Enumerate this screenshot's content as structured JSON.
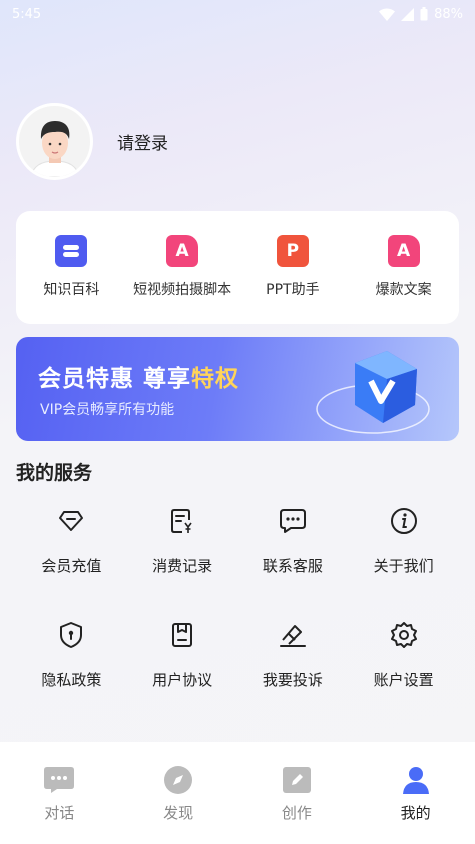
{
  "status_bar": {
    "time": "5:45",
    "battery": "88%"
  },
  "profile": {
    "login_text": "请登录"
  },
  "tools": [
    {
      "label": "知识百科",
      "icon": "encyclopedia-icon",
      "color": "#4f5bf0"
    },
    {
      "label": "短视频拍摄脚本",
      "icon": "script-a-icon",
      "color": "#f2457b"
    },
    {
      "label": "PPT助手",
      "icon": "ppt-p-icon",
      "color": "#f0543c",
      "glyph": "P"
    },
    {
      "label": "爆款文案",
      "icon": "copywriting-a-icon",
      "color": "#f2457b"
    }
  ],
  "vip_banner": {
    "title_a": "会员特惠 尊享",
    "title_b": "特权",
    "subtitle": "VIP会员畅享所有功能"
  },
  "services_title": "我的服务",
  "services": [
    {
      "label": "会员充值",
      "icon": "diamond-icon"
    },
    {
      "label": "消费记录",
      "icon": "receipt-icon"
    },
    {
      "label": "联系客服",
      "icon": "chat-bubble-icon"
    },
    {
      "label": "关于我们",
      "icon": "info-icon"
    },
    {
      "label": "隐私政策",
      "icon": "shield-lock-icon"
    },
    {
      "label": "用户协议",
      "icon": "agreement-icon"
    },
    {
      "label": "我要投诉",
      "icon": "complaint-icon"
    },
    {
      "label": "账户设置",
      "icon": "gear-icon"
    }
  ],
  "tabs": [
    {
      "label": "对话",
      "icon": "message-icon"
    },
    {
      "label": "发现",
      "icon": "compass-icon"
    },
    {
      "label": "创作",
      "icon": "pencil-icon"
    },
    {
      "label": "我的",
      "icon": "user-icon",
      "active": true
    }
  ],
  "colors": {
    "accent": "#4a6cf7",
    "tab_inactive": "#bbbbbb"
  }
}
